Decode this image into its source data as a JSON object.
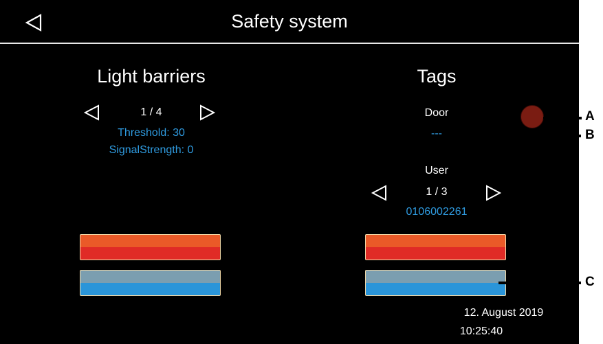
{
  "header": {
    "title": "Safety system"
  },
  "light_barriers": {
    "title": "Light barriers",
    "page": "1 / 4",
    "threshold": "Threshold: 30",
    "signal_strength": "SignalStrength: 0"
  },
  "tags": {
    "title": "Tags",
    "door_label": "Door",
    "door_value": "---",
    "user_label": "User",
    "user_page": "1 / 3",
    "user_id": "0106002261"
  },
  "datetime": {
    "date": "12. August 2019",
    "time": "10:25:40"
  },
  "callouts": {
    "a": "A",
    "b": "B",
    "c": "C"
  },
  "colors": {
    "background": "#000000",
    "accent_blue": "#2f9be0",
    "indicator": "#7a1c12",
    "red_button": "#e02b26",
    "blue_button": "#2a95d9"
  },
  "icons": {
    "back": "triangle-left-icon",
    "prev": "triangle-left-icon",
    "next": "triangle-right-icon"
  }
}
